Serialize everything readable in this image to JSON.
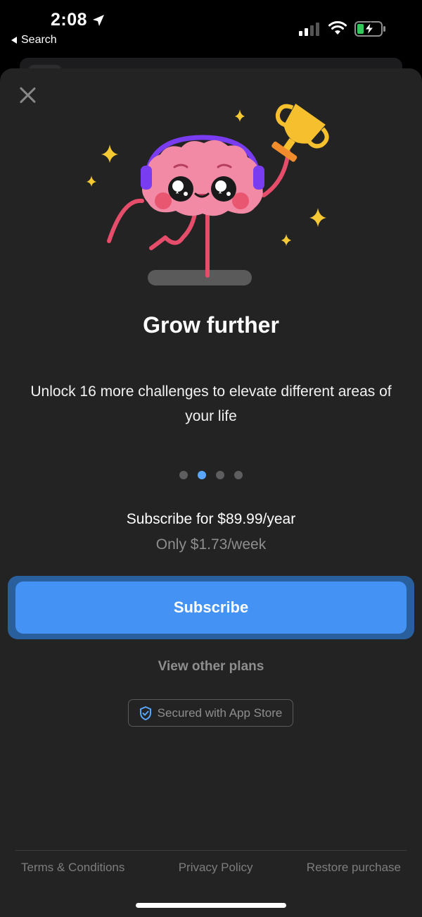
{
  "status_bar": {
    "time": "2:08",
    "back_label": "Search"
  },
  "paywall": {
    "title": "Grow further",
    "subtitle": "Unlock 16 more challenges to elevate different areas of your life",
    "page_dots": {
      "count": 4,
      "active_index": 1
    },
    "price_line": "Subscribe for $89.99/year",
    "per_week_line": "Only $1.73/week",
    "subscribe_label": "Subscribe",
    "other_plans_label": "View other plans",
    "secured_label": "Secured with App Store"
  },
  "footer": {
    "terms": "Terms & Conditions",
    "privacy": "Privacy Policy",
    "restore": "Restore purchase"
  },
  "colors": {
    "accent": "#4493f4",
    "sheet_background": "#232323",
    "muted_text": "#8e8e8e"
  },
  "icons": [
    "location-arrow-icon",
    "back-triangle-icon",
    "signal-icon",
    "wifi-icon",
    "battery-charging-icon",
    "close-icon",
    "shield-check-icon"
  ]
}
